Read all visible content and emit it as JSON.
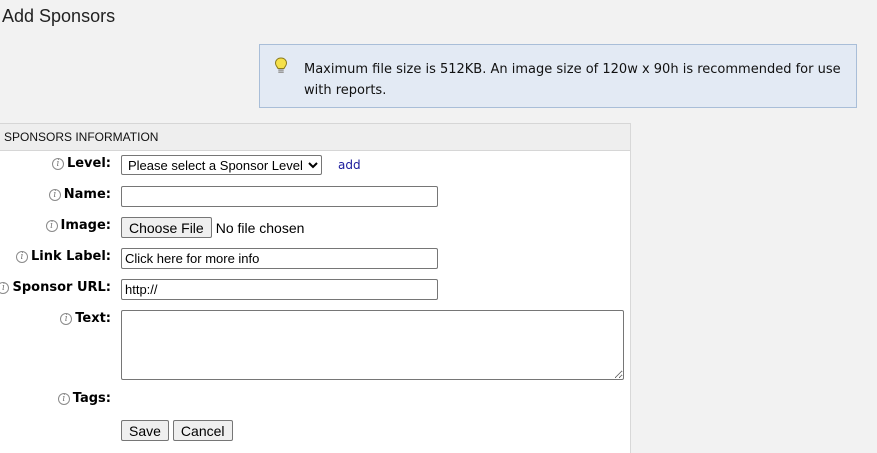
{
  "page": {
    "title": "Add Sponsors"
  },
  "notice": {
    "icon": "lightbulb-icon",
    "text": "Maximum file size is 512KB. An image size of 120w x 90h is recommended for use with reports."
  },
  "panel": {
    "header": "SPONSORS INFORMATION"
  },
  "form": {
    "level": {
      "label": "Level:",
      "selected": "Please select a Sponsor Level",
      "add_link": "add"
    },
    "name": {
      "label": "Name:",
      "value": ""
    },
    "image": {
      "label": "Image:",
      "button": "Choose File",
      "status": "No file chosen"
    },
    "link_label": {
      "label": "Link Label:",
      "value": "Click here for more info"
    },
    "sponsor_url": {
      "label": "Sponsor URL:",
      "value": "http://"
    },
    "text": {
      "label": "Text:",
      "value": ""
    },
    "tags": {
      "label": "Tags:"
    },
    "buttons": {
      "save": "Save",
      "cancel": "Cancel"
    }
  }
}
